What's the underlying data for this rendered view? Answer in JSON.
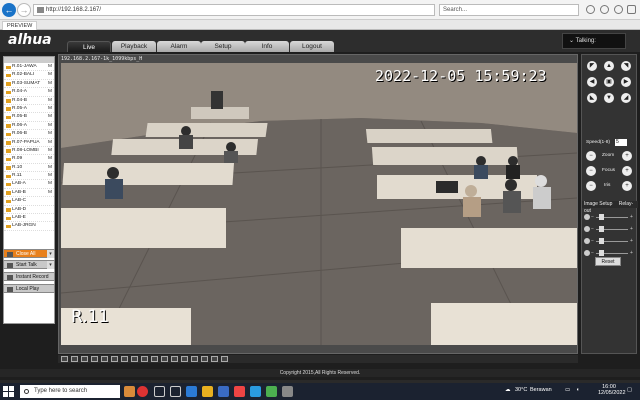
{
  "browser": {
    "address": "http://192.168.2.167/",
    "search_placeholder": "Search...",
    "tab_title": "PREVIEW"
  },
  "app": {
    "logo": "alhua",
    "tabs": [
      {
        "label": "Live",
        "active": true
      },
      {
        "label": "Playback",
        "active": false
      },
      {
        "label": "Alarm",
        "active": false
      },
      {
        "label": "Setup",
        "active": false
      },
      {
        "label": "Info",
        "active": false
      },
      {
        "label": "Logout",
        "active": false
      }
    ],
    "talking_label": "Talking:",
    "copyright": "Copyright 2015,All Rights Reserved."
  },
  "channels": [
    {
      "name": "R.01-JAWA",
      "mode": "M"
    },
    {
      "name": "R.02-BALI",
      "mode": "M"
    },
    {
      "name": "R.03-SUMAT",
      "mode": "M"
    },
    {
      "name": "R.04-A",
      "mode": "M"
    },
    {
      "name": "R.04-B",
      "mode": "M"
    },
    {
      "name": "R.05-A",
      "mode": "M"
    },
    {
      "name": "R.05-B",
      "mode": "M"
    },
    {
      "name": "R.06-A",
      "mode": "M"
    },
    {
      "name": "R.06-B",
      "mode": "M"
    },
    {
      "name": "R.07-PAPUA",
      "mode": "M"
    },
    {
      "name": "R.08-LOMBI",
      "mode": "M"
    },
    {
      "name": "R.09",
      "mode": "M"
    },
    {
      "name": "R.10",
      "mode": "M"
    },
    {
      "name": "R.11",
      "mode": "M"
    },
    {
      "name": "LAB-A",
      "mode": "M"
    },
    {
      "name": "LAB-B",
      "mode": "M"
    },
    {
      "name": "LAB-C",
      "mode": ""
    },
    {
      "name": "LAB-D",
      "mode": ""
    },
    {
      "name": "LAB-E",
      "mode": ""
    },
    {
      "name": "LAB-JRGN",
      "mode": ""
    }
  ],
  "side_buttons": {
    "close_all": "Close All",
    "start_talk": "Start Talk",
    "instant_record": "Instant Record",
    "local_play": "Local Play"
  },
  "video": {
    "info": "192.168.2.167-1k_1099kbps_H",
    "timestamp": "2022-12-05 15:59:23",
    "room_label": "R.11"
  },
  "ptz": {
    "speed_label": "Speed(1-8)",
    "speed_value": "5",
    "zoom_label": "Zoom",
    "focus_label": "Focus",
    "iris_label": "Iris",
    "image_setup_label": "Image Setup",
    "relay_out_label": "Relay-out",
    "reset_label": "Reset"
  },
  "taskbar": {
    "search_placeholder": "Type here to search",
    "weather_temp": "30°C",
    "weather_text": "Berawan",
    "time": "16:00",
    "date": "12/05/2022"
  }
}
